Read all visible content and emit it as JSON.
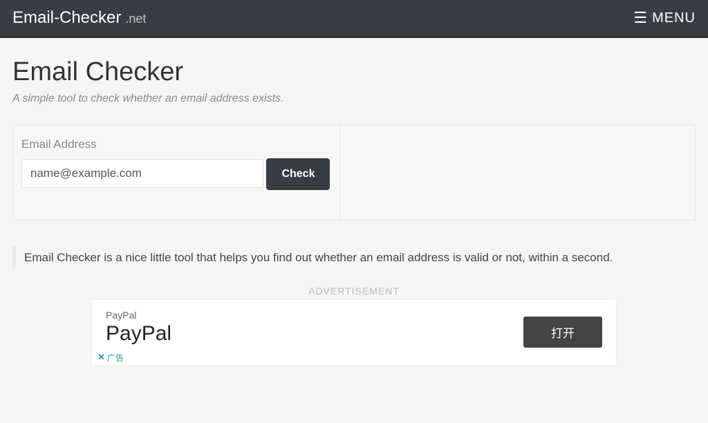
{
  "header": {
    "logo_main": "Email-Checker",
    "logo_suffix": ".net",
    "menu_label": "MENU"
  },
  "main": {
    "title": "Email Checker",
    "subtitle": "A simple tool to check whether an email address exists.",
    "form": {
      "label": "Email Address",
      "placeholder": "name@example.com",
      "button_label": "Check"
    },
    "description": "Email Checker is a nice little tool that helps you find out whether an email address is valid or not, within a second."
  },
  "advertisement": {
    "label": "ADVERTISEMENT",
    "brand_small": "PayPal",
    "brand_large": "PayPal",
    "cta_button": "打开",
    "close_text": "广告"
  }
}
